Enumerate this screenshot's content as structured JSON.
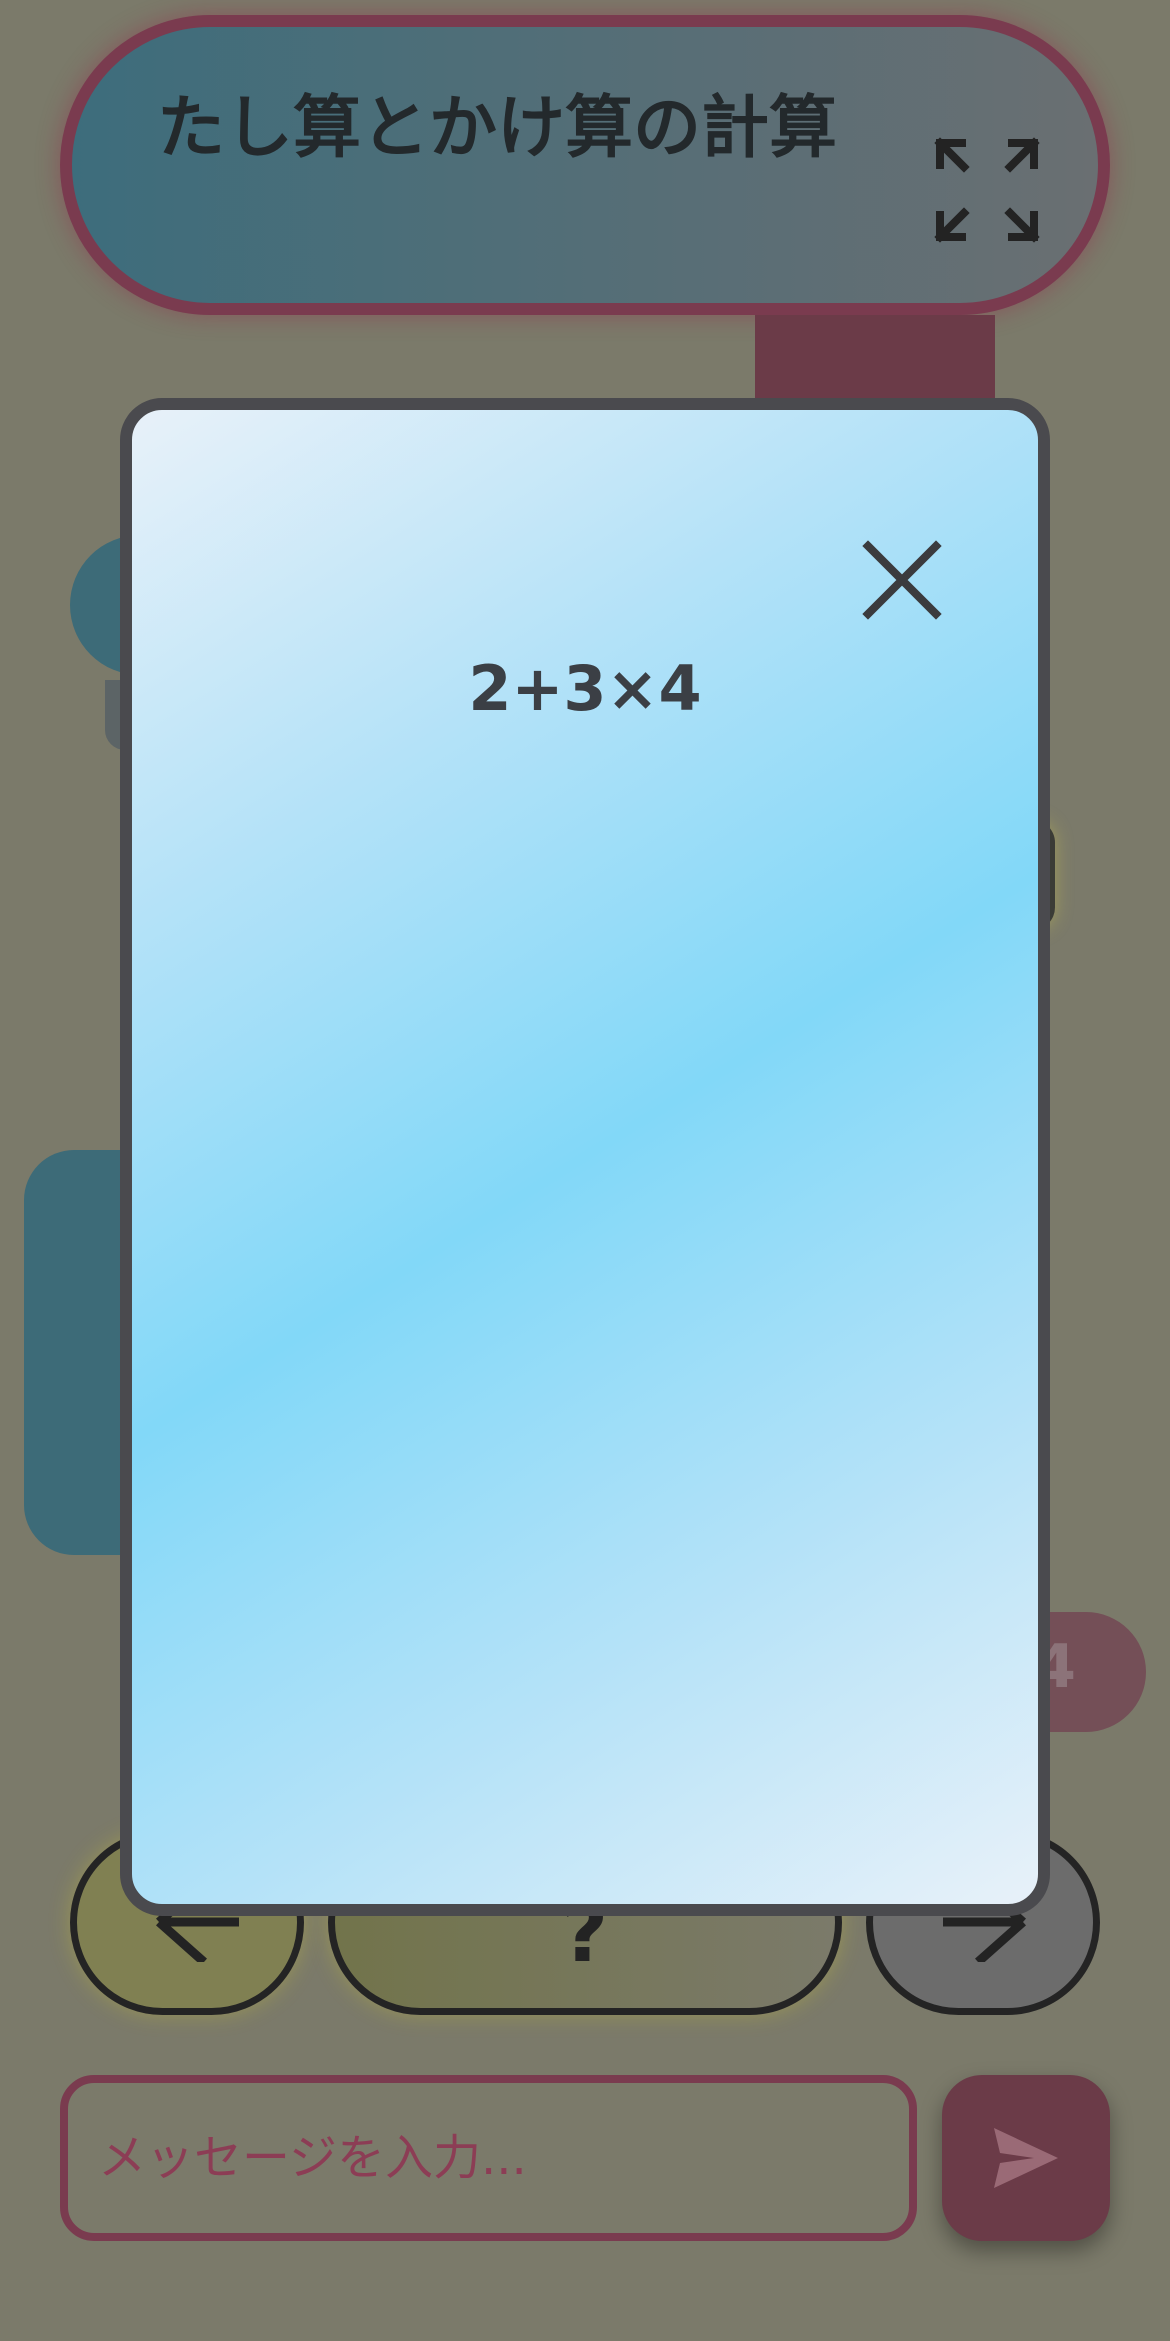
{
  "header": {
    "title": "たし算とかけ算の計算",
    "expand_icon": "expand-arrows-icon"
  },
  "chat": {
    "right_pill_text": "4"
  },
  "navigation": {
    "prev_icon": "chevron-left-icon",
    "hint_label": "?",
    "next_icon": "chevron-right-icon"
  },
  "composer": {
    "placeholder": "メッセージを入力...",
    "send_icon": "send-icon"
  },
  "modal": {
    "expression": "2+3×4",
    "close_icon": "close-icon"
  },
  "colors": {
    "backdrop": "#7b7a6a",
    "accent": "#7a3b4f",
    "modal_border": "#4a4a4e",
    "modal_gradient_mid": "#82d8f8"
  }
}
